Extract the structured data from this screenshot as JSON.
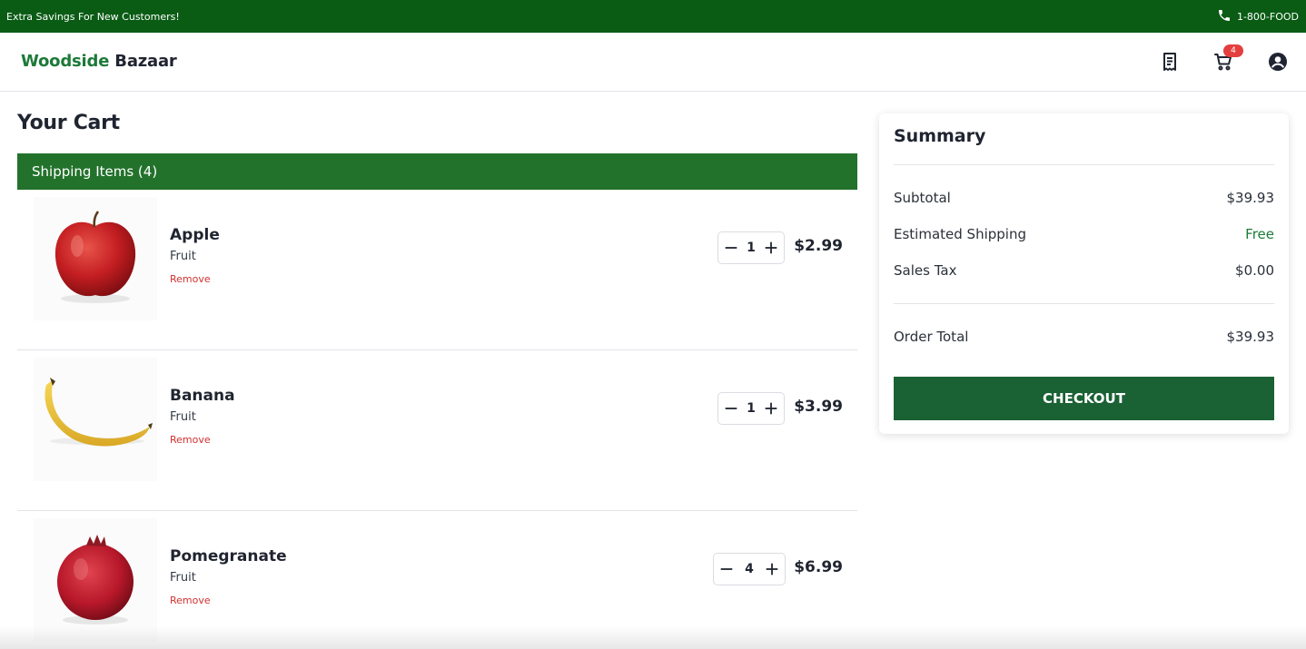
{
  "promo": {
    "message": "Extra Savings For New Customers!",
    "phone": "1-800-FOOD"
  },
  "header": {
    "logo_part_1": "Woodside",
    "logo_part_2": "Bazaar",
    "cart_count": "4",
    "icons": [
      "receipt-icon",
      "cart-icon",
      "account-icon"
    ]
  },
  "cart": {
    "title": "Your Cart",
    "shipping_label": "Shipping Items (4)",
    "items": [
      {
        "name": "Apple",
        "category": "Fruit",
        "remove_label": "Remove",
        "quantity": "1",
        "price": "$2.99"
      },
      {
        "name": "Banana",
        "category": "Fruit",
        "remove_label": "Remove",
        "quantity": "1",
        "price": "$3.99"
      },
      {
        "name": "Pomegranate",
        "category": "Fruit",
        "remove_label": "Remove",
        "quantity": "4",
        "price": "$6.99"
      }
    ]
  },
  "summary": {
    "title": "Summary",
    "subtotal_label": "Subtotal",
    "subtotal_value": "$39.93",
    "shipping_label": "Estimated Shipping",
    "shipping_value": "Free",
    "tax_label": "Sales Tax",
    "tax_value": "$0.00",
    "total_label": "Order Total",
    "total_value": "$39.93",
    "checkout_label": "CHECKOUT"
  },
  "colors": {
    "promo_bg": "#0a5c15",
    "brand_green": "#1c7a38",
    "shipping_bar": "#23722c",
    "checkout_bg": "#1a6134",
    "remove_red": "#d32f2f",
    "badge_red": "#e53e3e"
  }
}
